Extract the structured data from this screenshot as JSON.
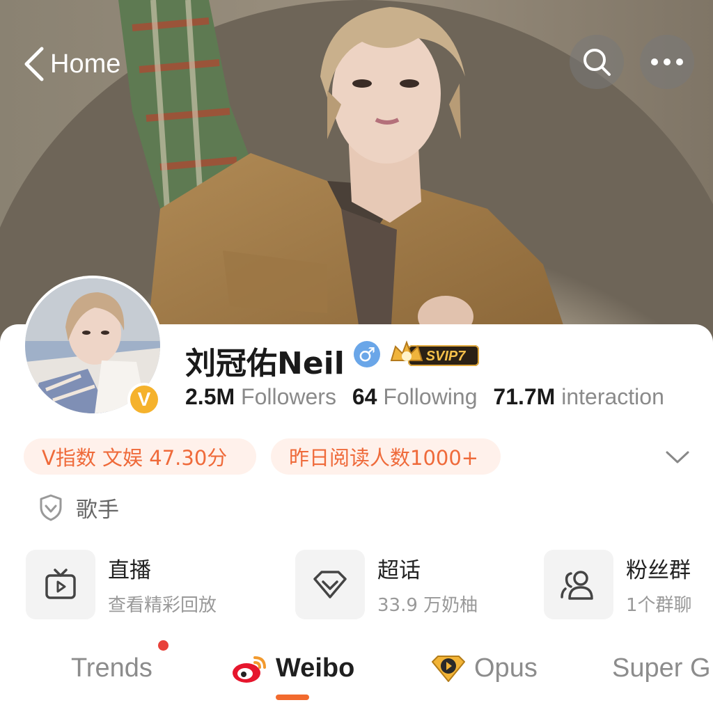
{
  "header": {
    "back_label": "Home",
    "search_icon": "search-icon",
    "more_icon": "more-dots-icon"
  },
  "profile": {
    "name": "刘冠佑Neil",
    "gender_symbol": "♂",
    "vip_badge": "SVIP7",
    "verified_badge": "V",
    "stats": [
      {
        "value": "2.5M",
        "label": "Followers"
      },
      {
        "value": "64",
        "label": "Following"
      },
      {
        "value": "71.7M",
        "label": "interaction"
      }
    ],
    "tags": [
      "V指数 文娱 47.30分",
      "昨日阅读人数1000+"
    ],
    "role": "歌手"
  },
  "entries": [
    {
      "title": "直播",
      "subtitle": "查看精彩回放",
      "icon": "tv-play-icon"
    },
    {
      "title": "超话",
      "subtitle": "33.9 万奶柚",
      "icon": "diamond-icon"
    },
    {
      "title": "粉丝群",
      "subtitle": "1个群聊",
      "icon": "group-users-icon"
    }
  ],
  "tabs": [
    {
      "label": "Trends",
      "active": false,
      "has_dot": true
    },
    {
      "label": "Weibo",
      "active": true,
      "icon": "weibo-logo-icon"
    },
    {
      "label": "Opus",
      "active": false,
      "icon": "opus-play-icon"
    },
    {
      "label": "Super G",
      "active": false
    }
  ],
  "colors": {
    "accent": "#f26a2e",
    "tag_bg": "#fff1eb",
    "tag_text": "#ef6a3a",
    "verified": "#f5b22c",
    "gender": "#6aa6e8"
  }
}
